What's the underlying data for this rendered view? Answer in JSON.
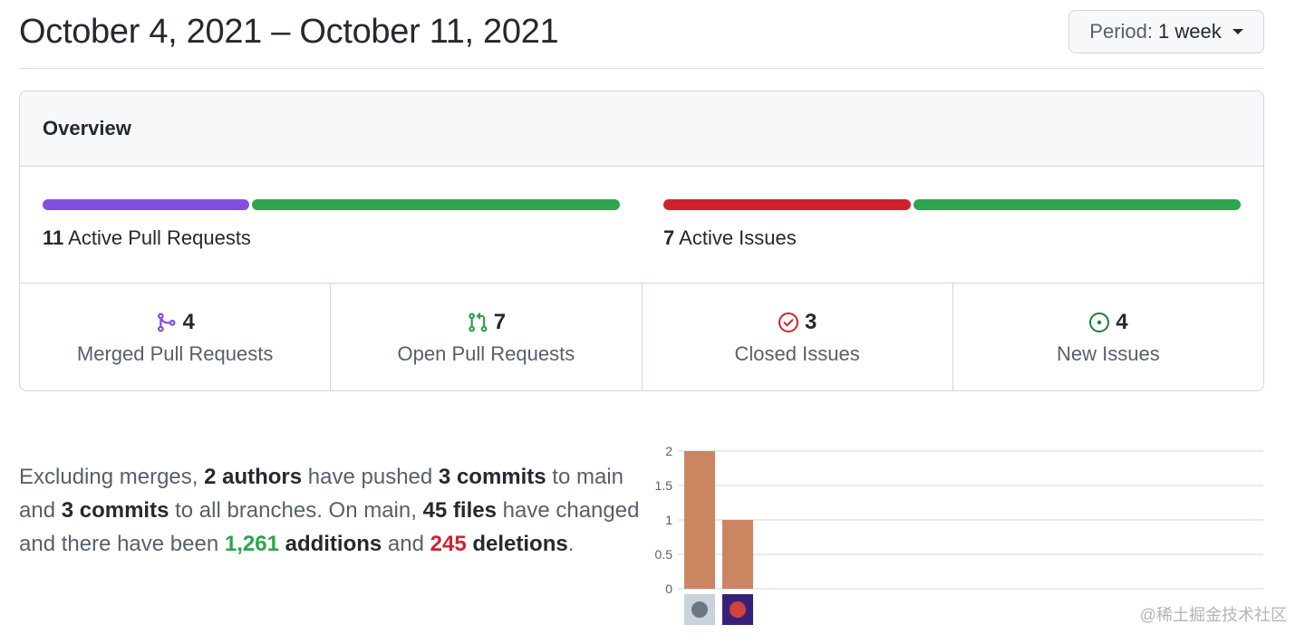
{
  "header": {
    "date_range": "October 4, 2021 – October 11, 2021",
    "period_label": "Period:",
    "period_value": "1 week"
  },
  "overview": {
    "title": "Overview",
    "pull_requests": {
      "count": "11",
      "label": "Active Pull Requests",
      "merged_fraction": 0.36,
      "colors": {
        "merged": "#8250df",
        "open": "#2da44e"
      }
    },
    "issues": {
      "count": "7",
      "label": "Active Issues",
      "closed_fraction": 0.43,
      "colors": {
        "closed": "#cf222e",
        "new": "#2da44e"
      }
    },
    "stats": [
      {
        "icon": "merge-icon",
        "value": "4",
        "label": "Merged Pull Requests",
        "color": "#8250df"
      },
      {
        "icon": "pull-request-icon",
        "value": "7",
        "label": "Open Pull Requests",
        "color": "#2da44e"
      },
      {
        "icon": "issue-closed-icon",
        "value": "3",
        "label": "Closed Issues",
        "color": "#cf222e"
      },
      {
        "icon": "issue-opened-icon",
        "value": "4",
        "label": "New Issues",
        "color": "#1a7f37"
      }
    ]
  },
  "summary": {
    "p1": "Excluding merges, ",
    "authors": "2 authors",
    "p2": " have pushed ",
    "commits_main": "3 commits",
    "p3": " to main and ",
    "commits_all": "3 commits",
    "p4": " to all branches. On main, ",
    "files": "45 files",
    "p5": " have changed and there have been ",
    "additions_num": "1,261",
    "additions_word": " additions",
    "p6": " and ",
    "deletions_num": "245",
    "deletions_word": " deletions",
    "p7": "."
  },
  "chart_data": {
    "type": "bar",
    "categories": [
      "author-1",
      "author-2"
    ],
    "values": [
      2,
      1
    ],
    "ylim": [
      0,
      2
    ],
    "yticks": [
      "0",
      "0.5",
      "1",
      "1.5",
      "2"
    ],
    "bar_color": "#cc8561",
    "grid": true
  },
  "watermark": "@稀土掘金技术社区"
}
